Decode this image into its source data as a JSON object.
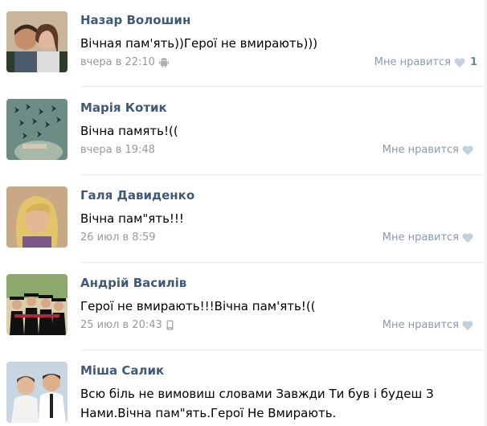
{
  "comments": [
    {
      "author": "Назар Волошин",
      "text": "Вічная пам'ять))Герої не вмирають)))",
      "time": "вчера в 22:10",
      "device_icon": "android-icon",
      "like_label": "Мне нравится",
      "like_count": "1"
    },
    {
      "author": "Марія Котик",
      "text": "Вічна память!((",
      "time": "вчера в 19:48",
      "like_label": "Мне нравится"
    },
    {
      "author": "Галя Давиденко",
      "text": "Вічна пам\"ять!!!",
      "time": "26 июл в 8:59",
      "like_label": "Мне нравится"
    },
    {
      "author": "Андрій Василів",
      "text": "Герої не вмирають!!!Вічна пам'ять!((",
      "time": "25 июл в 20:43",
      "device_icon": "mobile-phone-icon",
      "like_label": "Мне нравится"
    },
    {
      "author": "Міша Салик",
      "text_line1": "Всю біль не вимовиш словами Завжди Ти був і будеш З",
      "text_line2": "Нами.Вічна пам\"ять.Герої Не Вмирають."
    }
  ],
  "colors": {
    "link": "#3e5a78",
    "meta": "#999999",
    "like": "#8a9aad",
    "heart": "#c3d0de"
  }
}
